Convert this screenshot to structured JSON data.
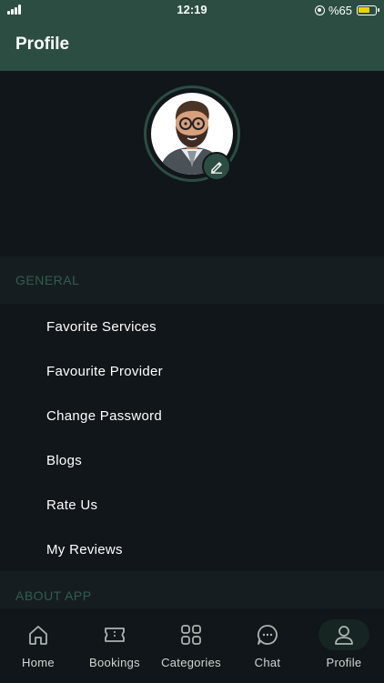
{
  "status_bar": {
    "time": "12:19",
    "battery": "%65"
  },
  "header": {
    "title": "Profile"
  },
  "sections": [
    {
      "title": "GENERAL",
      "items": [
        "Favorite Services",
        "Favourite Provider",
        "Change Password",
        "Blogs",
        "Rate Us",
        "My Reviews"
      ]
    },
    {
      "title": "ABOUT APP",
      "items": []
    }
  ],
  "bottom_nav": [
    {
      "label": "Home",
      "icon": "home-icon",
      "active": false
    },
    {
      "label": "Bookings",
      "icon": "ticket-icon",
      "active": false
    },
    {
      "label": "Categories",
      "icon": "grid-icon",
      "active": false
    },
    {
      "label": "Chat",
      "icon": "chat-icon",
      "active": false
    },
    {
      "label": "Profile",
      "icon": "user-icon",
      "active": true
    }
  ],
  "colors": {
    "header_bg": "#2b4d42",
    "page_bg": "#11161a",
    "section_bg": "#161d20",
    "section_text": "#2f5d4e",
    "battery": "#f2d100"
  }
}
